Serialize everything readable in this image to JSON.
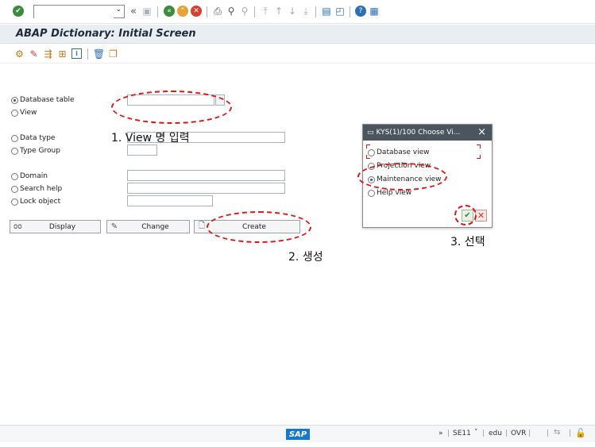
{
  "toolbar": {
    "command_field": "",
    "nav_symbol": "«",
    "icons": [
      "enter-icon",
      "save-icon",
      "back-icon",
      "exit-icon",
      "cancel-icon",
      "print-icon",
      "find-icon",
      "find-next-icon",
      "first-page-icon",
      "previous-page-icon",
      "next-page-icon",
      "last-page-icon",
      "new-session-icon",
      "shortcut-icon",
      "help-icon",
      "customize-layout-icon"
    ]
  },
  "titlebar": {
    "title": "ABAP Dictionary: Initial Screen"
  },
  "form": {
    "database_table": "Database table",
    "view": "View",
    "data_type": "Data type",
    "type_group": "Type Group",
    "domain": "Domain",
    "search_help": "Search help",
    "lock_object": "Lock object",
    "selected": "View"
  },
  "buttons": {
    "display": "Display",
    "change": "Change",
    "create": "Create"
  },
  "annotations": {
    "step1": "1. View 명 입력",
    "step2": "2. 생성",
    "step3": "3. 선택"
  },
  "popup": {
    "title": "KYS(1)/100 Choose Vi...",
    "close": "×",
    "options": [
      "Database view",
      "Projection view",
      "Maintenance view",
      "Help view"
    ],
    "selected": "Maintenance view"
  },
  "status": {
    "sap_logo": "SAP",
    "expand": "»",
    "transaction": "SE11",
    "transaction_dropdown": "˅",
    "client": "edu",
    "mode": "OVR"
  },
  "colors": {
    "annotation_red": "#e01414",
    "title_bg": "#e9eef3",
    "popup_header": "#4a5560",
    "sap_blue": "#1878c9"
  }
}
